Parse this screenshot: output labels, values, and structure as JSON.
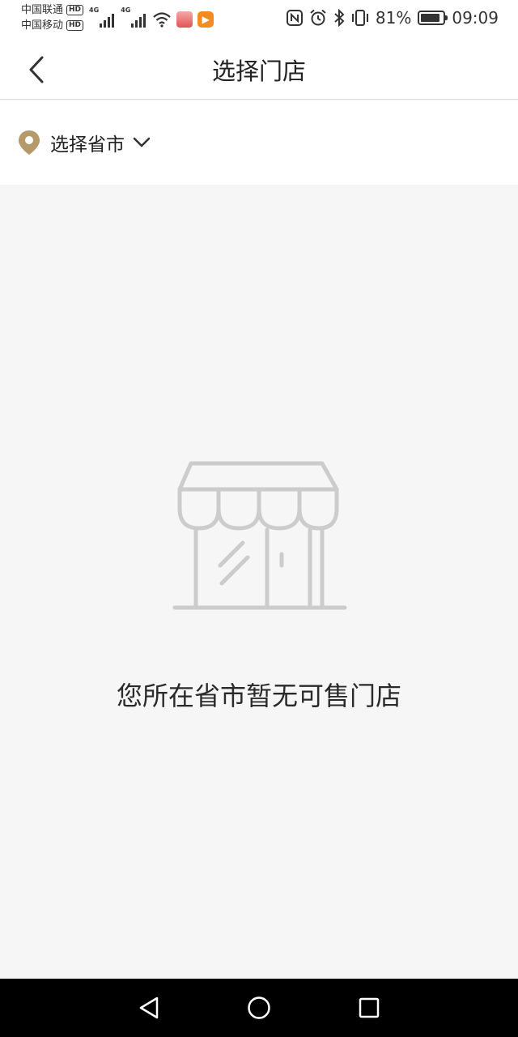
{
  "status_bar": {
    "carriers": [
      {
        "name": "中国联通",
        "badge": "HD"
      },
      {
        "name": "中国移动",
        "badge": "HD"
      }
    ],
    "network_type": "4G",
    "battery_text": "81%",
    "battery_level": 0.81,
    "time": "09:09"
  },
  "header": {
    "title": "选择门店"
  },
  "selector": {
    "label": "选择省市",
    "accent_color": "#b49a6b"
  },
  "empty_state": {
    "message": "您所在省市暂无可售门店",
    "illustration_color": "#cccccc"
  },
  "icons": {
    "back": "chevron-left-icon",
    "location": "location-pin-icon",
    "dropdown": "chevron-down-icon",
    "store": "store-icon",
    "nav_back": "triangle-back-icon",
    "nav_home": "circle-home-icon",
    "nav_recent": "square-recent-icon"
  }
}
